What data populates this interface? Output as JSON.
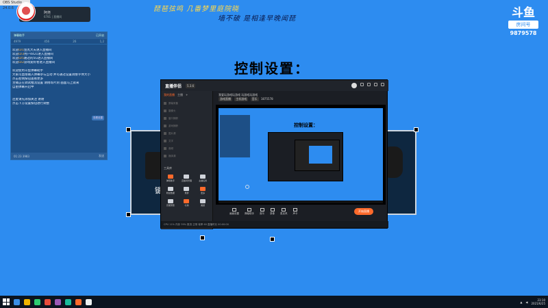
{
  "window": {
    "title": "OBS Studio - 24.0.6"
  },
  "profile": {
    "name": "阿尧",
    "sub": "6781 | 直播间"
  },
  "overlay": {
    "line1": "琵琶弦鸣 几番梦里庭院晓",
    "line2": "墙不破 是相逢早晚闻琵",
    "heading": "控制设置："
  },
  "douyu": {
    "logo": "斗鱼",
    "tag": "房间号",
    "room": "9879578"
  },
  "chat": {
    "header_left": "弹幕助手",
    "header_right": "已开启",
    "stats": [
      "4979",
      "456",
      "26",
      "1,2"
    ],
    "lines": [
      {
        "pre": "欢迎",
        "lv": "LV1",
        "text": "鱼丸大夫进入直播间"
      },
      {
        "pre": "欢迎",
        "lv": "LV3",
        "text": "用户4421进入直播间"
      },
      {
        "pre": "欢迎",
        "lv": "LV5",
        "text": "路过的5G进入直播间"
      },
      {
        "pre": "欢迎",
        "lv": "LV2",
        "text": "游戏爱好者进入直播间"
      }
    ],
    "notes": [
      "欢迎使用斗鱼弹幕助手",
      "大家可直接输入弹幕参与互动 并可通过设置调整字体大小",
      "点击右侧按钮查看更多",
      "主播正在调试推流设置 请稍等片刻 画面马上就来",
      "自由弹幕开启中"
    ],
    "badge": "查看设置",
    "notes2": [
      "连麦请先添加关注 谢谢",
      "点击下方设置按钮进行调整"
    ],
    "footer_left": "01:23 3983",
    "footer_right": "发送"
  },
  "bg": {
    "key_text": "键"
  },
  "app": {
    "brand": "直播伴侣",
    "version": "5.3.6",
    "side_tabs": [
      "我的直播",
      "主播",
      "+"
    ],
    "side_items": [
      "屏幕采集",
      "摄像头",
      "窗口捕获",
      "游戏捕获",
      "图片源",
      "文字",
      "音频",
      "媒体源"
    ],
    "tools_title": "工具库",
    "tools": [
      {
        "name": "弹幕助手",
        "w": false
      },
      {
        "name": "直播间管理",
        "w": true
      },
      {
        "name": "主播任务",
        "w": true
      },
      {
        "name": "粉丝数据",
        "w": true
      },
      {
        "name": "录屏",
        "w": true
      },
      {
        "name": "更多",
        "w": false
      },
      {
        "name": "高能预警",
        "w": true
      },
      {
        "name": "礼物",
        "w": false
      },
      {
        "name": "美颜",
        "w": true
      }
    ],
    "info": {
      "title": "我爱玩游戏玩游戏 玩游戏玩游戏",
      "pills": [
        "游戏直播",
        "主机游戏",
        "音乐"
      ],
      "stats": "1875578"
    },
    "preview_heading": "控制设置：",
    "controls": [
      "画面设置",
      "弹幕助手",
      "音乐",
      "录像",
      "麦克风",
      "声卡"
    ],
    "start_button": "开始直播",
    "status": "CPU 11%  内存 39%  推流 正常  帧率 60  直播时长 00:00:00"
  },
  "taskbar": {
    "time": "23:10",
    "date": "2021/6/25"
  }
}
